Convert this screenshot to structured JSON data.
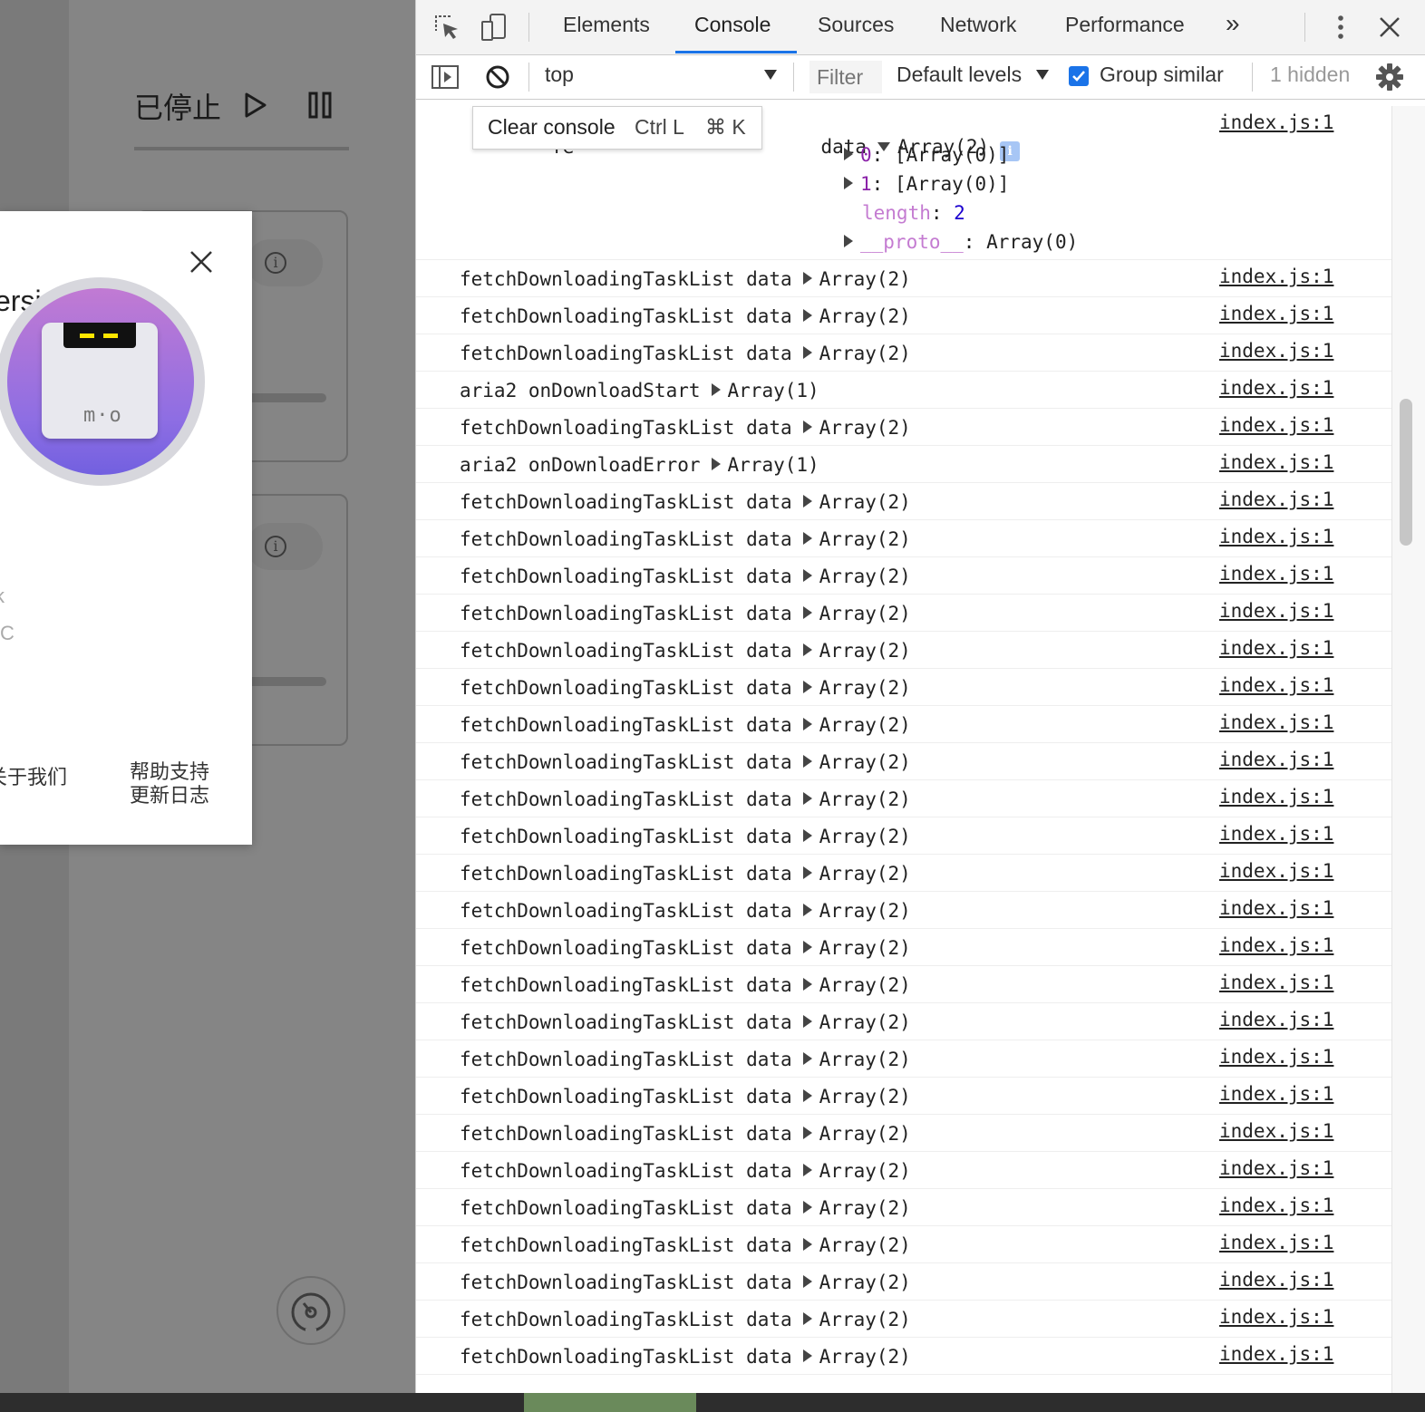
{
  "app": {
    "status_title": "已停止",
    "about": {
      "version_fragment": "ersi",
      "logo_text": "m·o",
      "fragment_1": "k",
      "fragment_2": "C",
      "link_about": "关于我们",
      "link_help_1": "帮助支持",
      "link_help_2": "更新日志"
    }
  },
  "devtools": {
    "tabs": [
      "Elements",
      "Console",
      "Sources",
      "Network",
      "Performance"
    ],
    "active_tab": "Console",
    "more_tabs": "»",
    "context": "top",
    "filter_placeholder": "Filter",
    "levels": "Default levels",
    "group_similar": "Group similar",
    "group_similar_checked": true,
    "hidden_count": "1 hidden",
    "tooltip": {
      "label": "Clear console",
      "keys": "Ctrl L",
      "mac": "⌘ K"
    },
    "accent_color": "#1a73e8",
    "expanded_entry": {
      "prefix": "fe",
      "tail": "data",
      "value": "Array(2)",
      "items": [
        {
          "key": "0",
          "value": "[Array(0)]"
        },
        {
          "key": "1",
          "value": "[Array(0)]"
        }
      ],
      "length_key": "length",
      "length_value": "2",
      "proto_key": "__proto__",
      "proto_value": "Array(0)",
      "source": "index.js:1"
    },
    "log": [
      {
        "label": "fetchDownloadingTaskList data",
        "value": "Array(2)",
        "source": "index.js:1"
      },
      {
        "label": "fetchDownloadingTaskList data",
        "value": "Array(2)",
        "source": "index.js:1"
      },
      {
        "label": "fetchDownloadingTaskList data",
        "value": "Array(2)",
        "source": "index.js:1"
      },
      {
        "label": "aria2 onDownloadStart",
        "value": "Array(1)",
        "source": "index.js:1"
      },
      {
        "label": "fetchDownloadingTaskList data",
        "value": "Array(2)",
        "source": "index.js:1"
      },
      {
        "label": "aria2 onDownloadError",
        "value": "Array(1)",
        "source": "index.js:1"
      },
      {
        "label": "fetchDownloadingTaskList data",
        "value": "Array(2)",
        "source": "index.js:1"
      },
      {
        "label": "fetchDownloadingTaskList data",
        "value": "Array(2)",
        "source": "index.js:1"
      },
      {
        "label": "fetchDownloadingTaskList data",
        "value": "Array(2)",
        "source": "index.js:1"
      },
      {
        "label": "fetchDownloadingTaskList data",
        "value": "Array(2)",
        "source": "index.js:1"
      },
      {
        "label": "fetchDownloadingTaskList data",
        "value": "Array(2)",
        "source": "index.js:1"
      },
      {
        "label": "fetchDownloadingTaskList data",
        "value": "Array(2)",
        "source": "index.js:1"
      },
      {
        "label": "fetchDownloadingTaskList data",
        "value": "Array(2)",
        "source": "index.js:1"
      },
      {
        "label": "fetchDownloadingTaskList data",
        "value": "Array(2)",
        "source": "index.js:1"
      },
      {
        "label": "fetchDownloadingTaskList data",
        "value": "Array(2)",
        "source": "index.js:1"
      },
      {
        "label": "fetchDownloadingTaskList data",
        "value": "Array(2)",
        "source": "index.js:1"
      },
      {
        "label": "fetchDownloadingTaskList data",
        "value": "Array(2)",
        "source": "index.js:1"
      },
      {
        "label": "fetchDownloadingTaskList data",
        "value": "Array(2)",
        "source": "index.js:1"
      },
      {
        "label": "fetchDownloadingTaskList data",
        "value": "Array(2)",
        "source": "index.js:1"
      },
      {
        "label": "fetchDownloadingTaskList data",
        "value": "Array(2)",
        "source": "index.js:1"
      },
      {
        "label": "fetchDownloadingTaskList data",
        "value": "Array(2)",
        "source": "index.js:1"
      },
      {
        "label": "fetchDownloadingTaskList data",
        "value": "Array(2)",
        "source": "index.js:1"
      },
      {
        "label": "fetchDownloadingTaskList data",
        "value": "Array(2)",
        "source": "index.js:1"
      },
      {
        "label": "fetchDownloadingTaskList data",
        "value": "Array(2)",
        "source": "index.js:1"
      },
      {
        "label": "fetchDownloadingTaskList data",
        "value": "Array(2)",
        "source": "index.js:1"
      },
      {
        "label": "fetchDownloadingTaskList data",
        "value": "Array(2)",
        "source": "index.js:1"
      },
      {
        "label": "fetchDownloadingTaskList data",
        "value": "Array(2)",
        "source": "index.js:1"
      },
      {
        "label": "fetchDownloadingTaskList data",
        "value": "Array(2)",
        "source": "index.js:1"
      },
      {
        "label": "fetchDownloadingTaskList data",
        "value": "Array(2)",
        "source": "index.js:1"
      },
      {
        "label": "fetchDownloadingTaskList data",
        "value": "Array(2)",
        "source": "index.js:1"
      }
    ]
  }
}
